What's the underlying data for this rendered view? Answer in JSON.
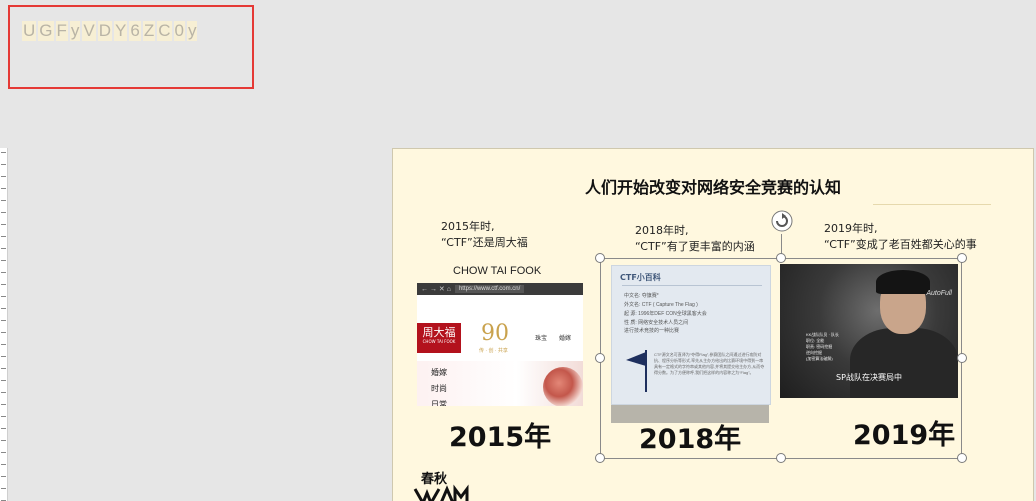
{
  "captcha": {
    "chars": [
      "U",
      "G",
      "F",
      "y",
      "V",
      "D",
      "Y",
      "6",
      "Z",
      "C",
      "0",
      "y"
    ]
  },
  "slide": {
    "title": "人们开始改变对网络安全竞赛的认知",
    "col2015": {
      "caption_line1": "2015年时,",
      "caption_line2": "“CTF”还是周大福",
      "brand_label": "CHOW TAI FOOK",
      "year": "2015年",
      "screenshot": {
        "url": "https://www.ctf.com.cn/",
        "logo_cn": "周大福",
        "logo_en": "CHOW TAI FOOK",
        "number": "90",
        "tagline": "传 · 创 · 共享",
        "nav_items": [
          "珠宝",
          "婚嫁"
        ],
        "menu_items": [
          "婚嫁",
          "时尚",
          "日常"
        ]
      }
    },
    "col2018": {
      "caption_line1": "2018年时,",
      "caption_line2": "“CTF”有了更丰富的内涵",
      "year": "2018年",
      "card": {
        "heading": "CTF小百科",
        "rows": [
          "中文名:    夺旗赛*",
          "外文名:    CTF ( Capture The Flag )",
          "起    源:    1996年DEF CON全球黑客大会",
          "性    质:    网络安全技术人员之间",
          "                进行技术竞技的一种比赛"
        ],
        "paragraph": "CTF源文名可直译为“夺得Flag”,参赛团队之间通过进行攻防对抗、程序分析等形式,率先从主办方给出的比赛环境中得到一串具有一定格式的字符串或其他内容,并将其提交给主办方,从而夺得分数。为了方便称呼,我们把这样的内容称之为“Flag”。"
      }
    },
    "col2019": {
      "caption_line1": "2019年时,",
      "caption_line2": "“CTF”变成了老百姓都关心的事",
      "year": "2019年",
      "photo": {
        "brand": "AutoFull",
        "info_lines": [
          "KK战队队员 · 队长",
          "职位: 全能",
          "职责: 密码挖掘",
          "逆向挖掘",
          "(加密算法破解)"
        ],
        "subtitle": "SP战队在决赛局中"
      }
    },
    "logo": {
      "text": "春秋GAME"
    }
  }
}
